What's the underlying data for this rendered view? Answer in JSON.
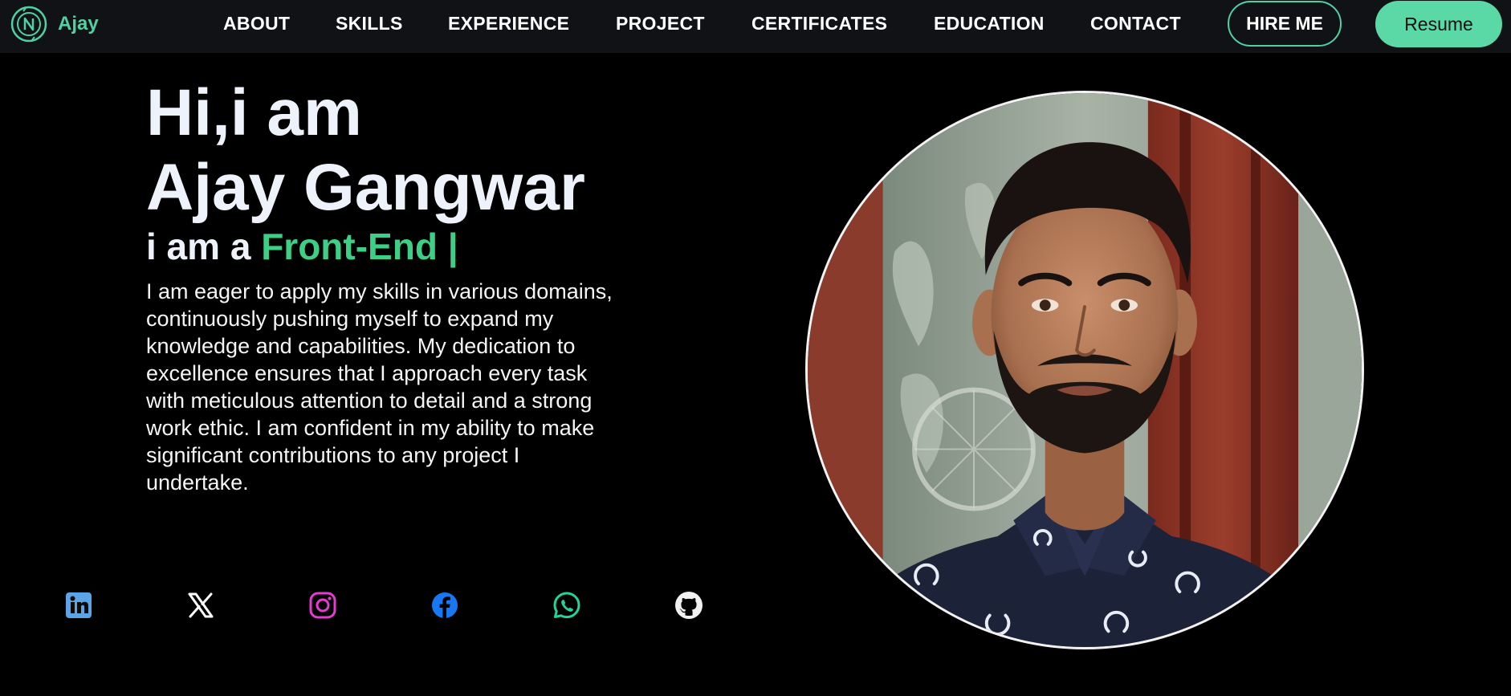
{
  "nav": {
    "brand": "Ajay",
    "links": [
      "ABOUT",
      "SKILLS",
      "EXPERIENCE",
      "PROJECT",
      "CERTIFICATES",
      "EDUCATION",
      "CONTACT"
    ],
    "hire_label": "HIRE ME",
    "resume_label": "Resume"
  },
  "hero": {
    "greeting": "Hi,i am",
    "name": "Ajay Gangwar",
    "role_prefix": "i am a",
    "role_accent": "Front-End |",
    "bio": "I am eager to apply my skills in various domains, continuously pushing myself to expand my knowledge and capabilities. My dedication to excellence ensures that I approach every task with meticulous attention to detail and a strong work ethic. I am confident in my ability to make significant contributions to any project I undertake."
  },
  "social": [
    {
      "icon": "linkedin-icon",
      "color": "#5ba4e6"
    },
    {
      "icon": "x-twitter-icon",
      "color": "#ffffff"
    },
    {
      "icon": "instagram-icon",
      "color": "#e53bd0"
    },
    {
      "icon": "facebook-icon",
      "color": "#1877f2"
    },
    {
      "icon": "whatsapp-icon",
      "color": "#25d39a"
    },
    {
      "icon": "github-icon",
      "color": "#f0f0f0"
    }
  ],
  "colors": {
    "accent": "#4fd1a1",
    "role_accent": "#3ecf86",
    "nav_bg": "#111216",
    "page_bg": "#000000",
    "resume_bg": "#5ad8a6"
  }
}
